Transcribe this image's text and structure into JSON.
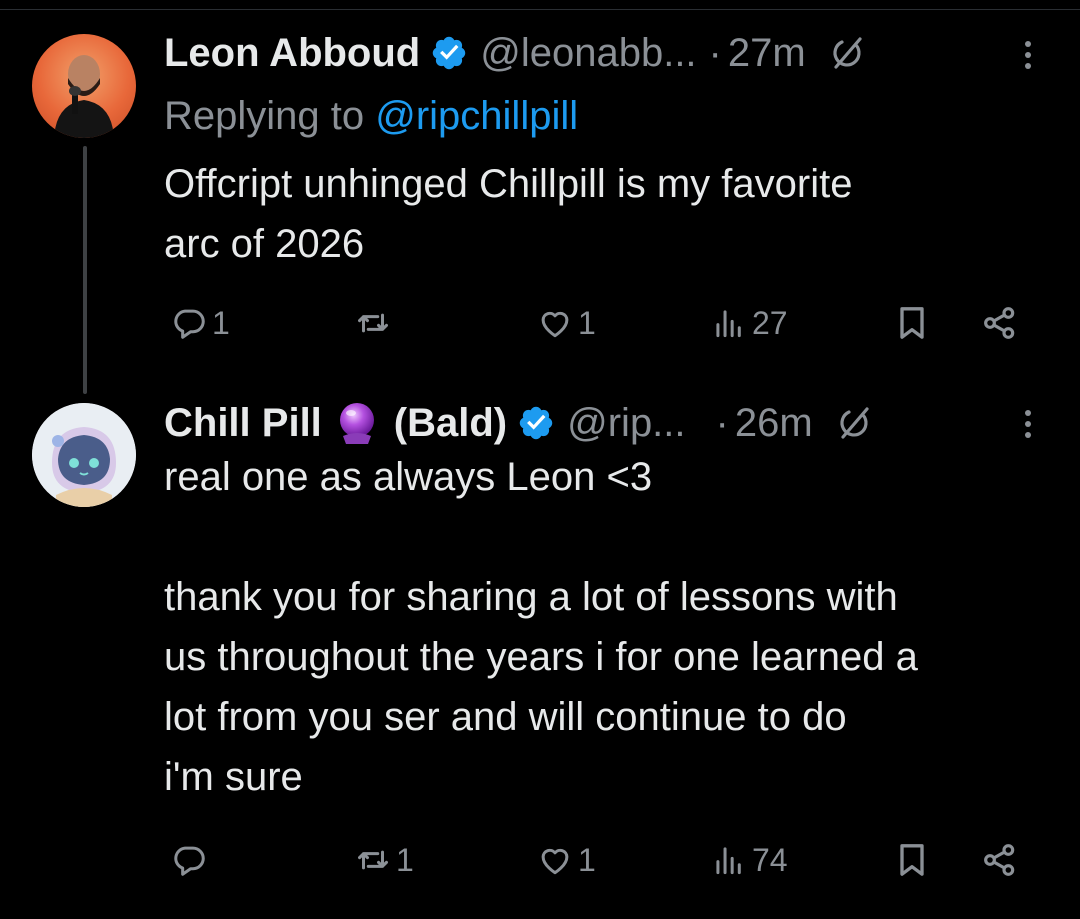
{
  "tweets": [
    {
      "name": "Leon Abboud",
      "handle": "@leonabb...",
      "dot": "·",
      "time": "27m",
      "replying_prefix": "Replying to ",
      "replying_to": "@ripchillpill",
      "text": [
        "Offcript unhinged Chillpill is my favorite",
        "arc of 2026"
      ],
      "actions": {
        "replies": "1",
        "reposts": "",
        "likes": "1",
        "views": "27"
      }
    },
    {
      "name": "Chill Pill",
      "name_suffix": "(Bald)",
      "handle": "@rip...",
      "dot": "·",
      "time": "26m",
      "text": [
        "real one as always Leon <3",
        "",
        "thank you for sharing a lot of lessons with",
        "us throughout the years i for one learned a",
        "lot from you ser and will continue to do",
        "i'm sure"
      ],
      "actions": {
        "replies": "",
        "reposts": "1",
        "likes": "1",
        "views": "74"
      }
    }
  ],
  "icons": {
    "verified": "verified-badge-icon",
    "grok": "grok-icon",
    "more": "more-icon",
    "reply": "reply-icon",
    "repost": "repost-icon",
    "like": "like-icon",
    "views": "views-icon",
    "bookmark": "bookmark-icon",
    "share": "share-icon",
    "crystal_ball": "crystal-ball-emoji"
  },
  "colors": {
    "background": "#000000",
    "text": "#e7e9ea",
    "muted": "#8b9096",
    "link": "#1d9bf0",
    "verified": "#1d9bf0"
  }
}
